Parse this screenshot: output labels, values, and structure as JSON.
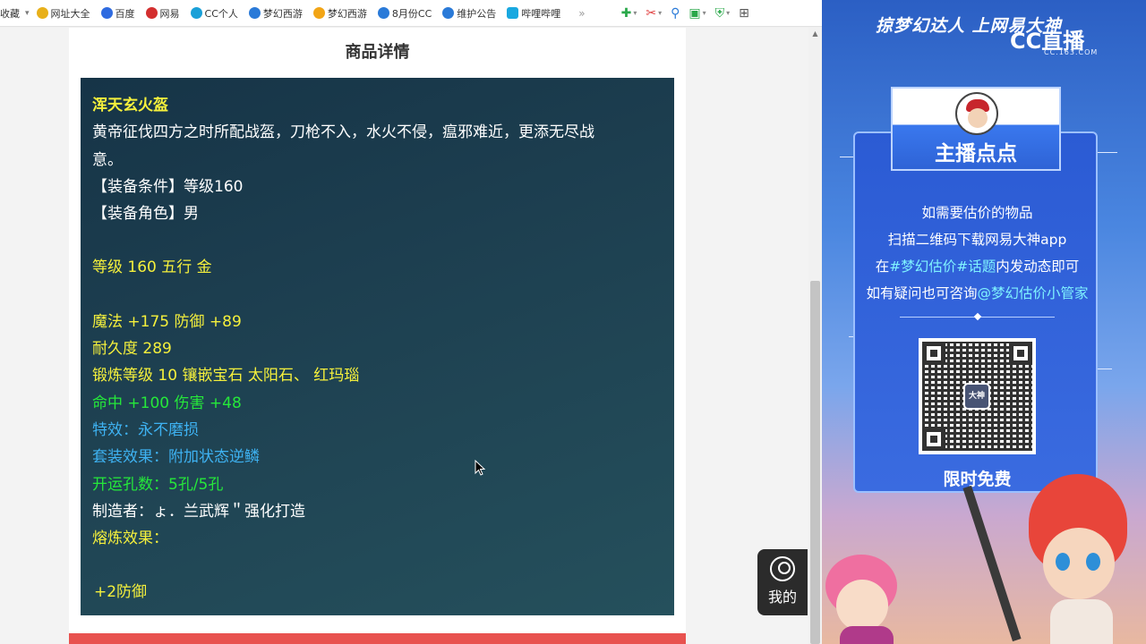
{
  "bookmarks": {
    "first": "收藏",
    "items": [
      {
        "label": "网址大全",
        "color": "#e8b01a"
      },
      {
        "label": "百度",
        "color": "#2f6be0"
      },
      {
        "label": "网易",
        "color": "#d32f2f"
      },
      {
        "label": "CC个人",
        "color": "#1aa0d8"
      },
      {
        "label": "梦幻西游",
        "color": "#2a7ad8"
      },
      {
        "label": "梦幻西游",
        "color": "#f2a516"
      },
      {
        "label": "8月份CC",
        "color": "#2a7ad8"
      },
      {
        "label": "维护公告",
        "color": "#2a7ad8"
      },
      {
        "label": "哔哩哔哩",
        "color": "#19a8e0"
      }
    ],
    "more": "»"
  },
  "toolbar": {
    "icons": [
      "apps-icon",
      "scissors-icon",
      "search-icon",
      "gamepad-icon",
      "shield-icon",
      "grid-icon"
    ]
  },
  "panel": {
    "title": "商品详情"
  },
  "item": {
    "name": "浑天玄火盔",
    "desc": "黄帝征伐四方之时所配战盔，刀枪不入，水火不侵，瘟邪难近，更添无尽战意。",
    "desc_line1": "黄帝征伐四方之时所配战盔，刀枪不入，水火不侵，瘟邪难近，更添无尽战",
    "desc_line2": "意。",
    "req_level": "【装备条件】等级160",
    "req_role": "【装备角色】男",
    "level_element": "等级 160 五行 金",
    "stats1": "魔法 +175 防御 +89",
    "durability": "耐久度 289",
    "forge": "锻炼等级 10 镶嵌宝石 太阳石、 红玛瑙",
    "stats2": "命中 +100 伤害 +48",
    "special": "特效：永不磨损",
    "set_effect": "套装效果：附加状态逆鳞",
    "holes": "开运孔数：5孔/5孔",
    "maker": "制造者：ょ．兰武辉＂强化打造",
    "smelt": "熔炼效果：",
    "smelt_value": "+2防御"
  },
  "my_button": {
    "label": "我的"
  },
  "side": {
    "slogan": "掠梦幻达人 上网易大神",
    "logo": "CC直播",
    "logo_sub": "CC.163.COM",
    "host_title": "主播点点",
    "lines": [
      "如需要估价的物品",
      "扫描二维码下载网易大神app"
    ],
    "line3_prefix": "在",
    "line3_hl": "#梦幻估价#话题",
    "line3_suffix": "内发动态即可",
    "line4_prefix": "如有疑问也可咨询",
    "line4_hl": "@梦幻估价小管家",
    "qr_label": "大神",
    "free": "限时免费"
  }
}
